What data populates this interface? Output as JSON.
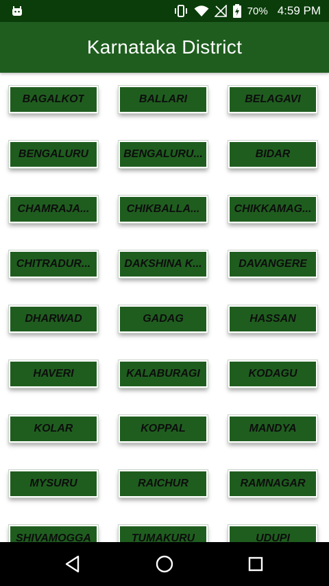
{
  "status_bar": {
    "battery_percent": "70%",
    "time": "4:59 PM",
    "icons": [
      "android-icon",
      "vibrate-icon",
      "wifi-icon",
      "no-sim-icon",
      "battery-charging-icon"
    ]
  },
  "app_bar": {
    "title": "Karnataka District"
  },
  "districts": [
    "BAGALKOT",
    "BALLARI",
    "BELAGAVI",
    "BENGALURU",
    "BENGALURU...",
    "BIDAR",
    "CHAMRAJA...",
    "CHIKBALLA...",
    "CHIKKAMAG...",
    "CHITRADUR...",
    "DAKSHINA K...",
    "DAVANGERE",
    "DHARWAD",
    "GADAG",
    "HASSAN",
    "HAVERI",
    "KALABURAGI",
    "KODAGU",
    "KOLAR",
    "KOPPAL",
    "MANDYA",
    "MYSURU",
    "RAICHUR",
    "RAMNAGAR",
    "SHIVAMOGGA",
    "TUMAKURU",
    "UDUPI"
  ],
  "nav_bar": {
    "icons": [
      "back-triangle-icon",
      "home-circle-icon",
      "recents-square-icon"
    ]
  },
  "colors": {
    "status_bar": "#0a3d0a",
    "app_bar": "#1f5d1f",
    "button": "#1f5d1f",
    "button_text": "#0d0d0d"
  }
}
